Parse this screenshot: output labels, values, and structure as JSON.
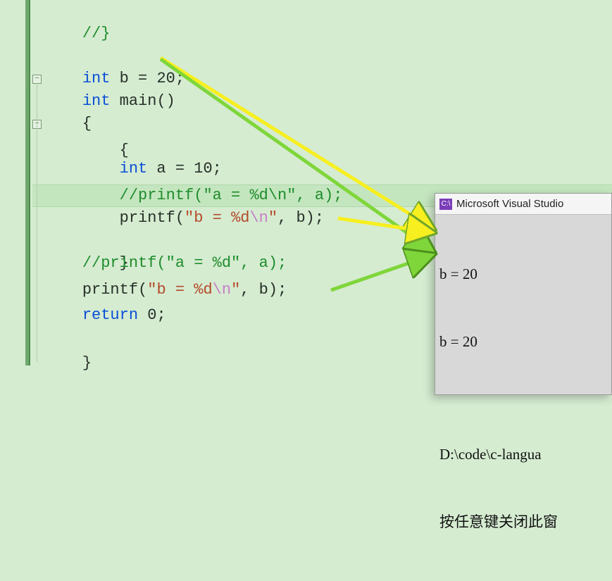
{
  "code": {
    "line1_comment": "//}",
    "line2_blank": "",
    "line3": {
      "kw": "int",
      "name": " b ",
      "eq": "= ",
      "val": "20",
      "semi": ";"
    },
    "line4": {
      "kw": "int",
      "fn": " main",
      "parens": "()"
    },
    "line5": "{",
    "line6": "    {",
    "line7": {
      "indent": "        ",
      "kw": "int",
      "name": " a ",
      "eq": "= ",
      "val": "10",
      "semi": ";"
    },
    "line8": {
      "indent": "        ",
      "text": "//printf(\"a = %d\\n\", a);"
    },
    "line9": {
      "indent": "        ",
      "fn": "printf",
      "open": "(",
      "q1": "\"",
      "lit1": "b = ",
      "pc": "%d",
      "esc": "\\n",
      "q2": "\"",
      "rest": ", b);"
    },
    "line10": "    }",
    "line11": {
      "indent": "    ",
      "text": "//printf(\"a = %d\", a);"
    },
    "line12": {
      "indent": "    ",
      "fn": "printf",
      "open": "(",
      "q1": "\"",
      "lit1": "b = ",
      "pc": "%d",
      "esc": "\\n",
      "q2": "\"",
      "rest": ", b);"
    },
    "line13": {
      "indent": "    ",
      "kw": "return",
      "sp": " ",
      "val": "0",
      "semi": ";"
    },
    "line14": "}"
  },
  "console": {
    "title": "Microsoft Visual Studio",
    "icon_text": "C:\\",
    "lines": [
      "b = 20",
      "b = 20",
      "",
      "D:\\code\\c-langua",
      "按任意键关闭此窗"
    ]
  },
  "fold_glyph": "−"
}
